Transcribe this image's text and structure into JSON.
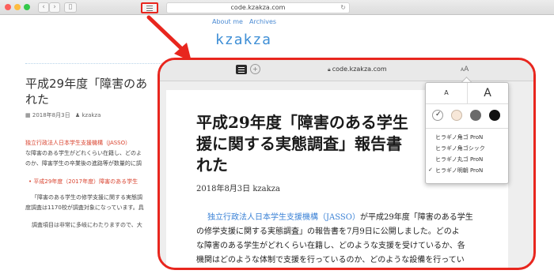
{
  "background_browser": {
    "address": "code.kzakza.com",
    "nav": {
      "about": "About me",
      "archives": "Archives"
    },
    "logo": "kzakza",
    "title_line1": "平成29年度「障害のあ",
    "title_line2": "れた",
    "meta_date": "2018年8月3日",
    "meta_author": "kzakza",
    "lines": [
      "独立行政法人日本学生支援機構（JASSO）",
      "な障害のある学生がどれくらい在籍し、どのよ",
      "のか、障害学生の卒業後の進路等が数量的に調",
      "平成29年度（2017年度）障害のある学生",
      "「障害のある学生の修学支援に関する実態調",
      "度調査は1170校が調査対象になっています。具",
      "調査項目は非常に多岐にわたりますので、大"
    ]
  },
  "reader": {
    "address": "code.kzakza.com",
    "aa_small": "A",
    "aa_large": "A",
    "title_line1": "平成29年度「障害のある学生",
    "title_line2": "援に関する実態調査」報告書",
    "title_line3": "れた",
    "meta": "2018年8月3日  kzakza",
    "para": {
      "link": "独立行政法人日本学生支援機構（JASSO）",
      "line1_rest": "が平成29年度「障害のある学生",
      "line2": "の修学支援に関する実態調査」の報告書を7月9日に公開しました。どのよ",
      "line3": "な障害のある学生がどれくらい在籍し、どのような支援を受けているか、各",
      "line4": "機関はどのような体制で支援を行っているのか、どのような設備を行ってい"
    }
  },
  "appearance": {
    "size_small": "A",
    "size_large": "A",
    "themes": [
      {
        "name": "white",
        "color": "#ffffff",
        "selected": true
      },
      {
        "name": "sepia",
        "color": "#f7e7d8",
        "selected": false
      },
      {
        "name": "gray",
        "color": "#6b6b6b",
        "selected": false
      },
      {
        "name": "night",
        "color": "#111111",
        "selected": false
      }
    ],
    "fonts": [
      {
        "label": "ヒラギノ角ゴ ProN",
        "selected": false
      },
      {
        "label": "ヒラギノ角ゴシック",
        "selected": false
      },
      {
        "label": "ヒラギノ丸ゴ ProN",
        "selected": false
      },
      {
        "label": "ヒラギノ明朝 ProN",
        "selected": true
      }
    ],
    "check_mark": "✓"
  },
  "colors": {
    "highlight": "#e8261e",
    "link": "#3b82d6"
  }
}
